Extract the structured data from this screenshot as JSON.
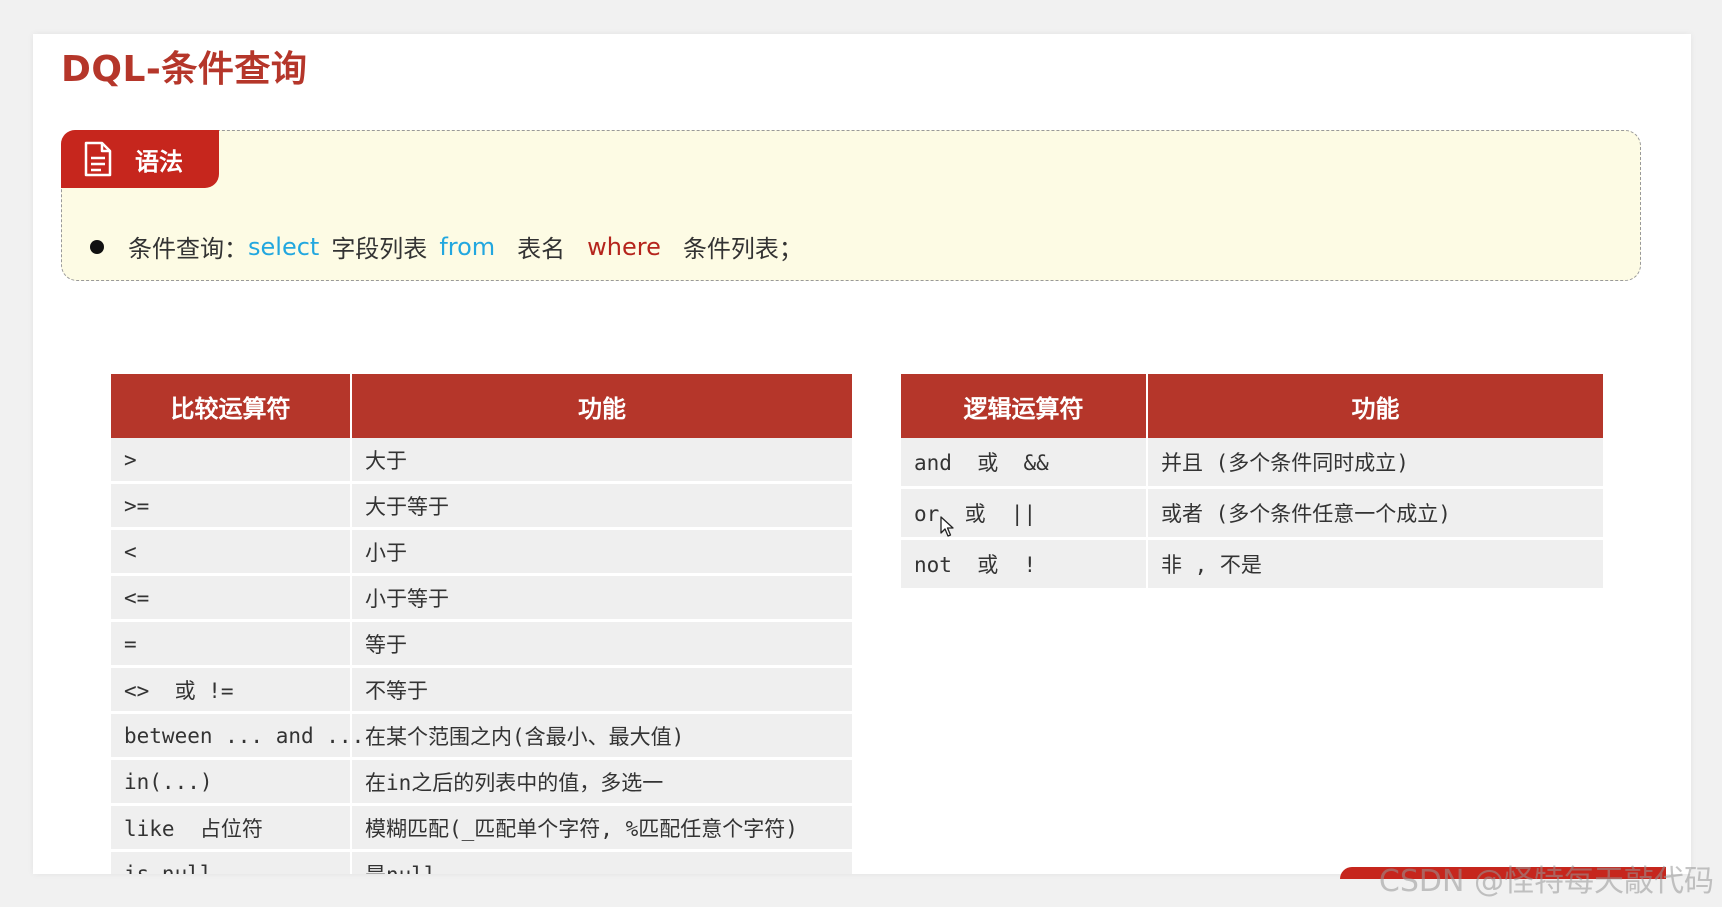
{
  "slide": {
    "title": "DQL-条件查询"
  },
  "syntax": {
    "tag_label": "语法",
    "prefix": "条件查询：",
    "kw_select": "select",
    "fields": "字段列表",
    "kw_from": "from",
    "table_name": "表名",
    "kw_where": "where",
    "conditions": "条件列表；"
  },
  "comparison_table": {
    "headers": [
      "比较运算符",
      "功能"
    ],
    "rows": [
      [
        ">",
        "大于"
      ],
      [
        ">=",
        "大于等于"
      ],
      [
        "<",
        "小于"
      ],
      [
        "<=",
        "小于等于"
      ],
      [
        "=",
        "等于"
      ],
      [
        "<>  或 !=",
        "不等于"
      ],
      [
        "between ... and ...",
        "在某个范围之内(含最小、最大值)"
      ],
      [
        "in(...)",
        "在in之后的列表中的值，多选一"
      ],
      [
        "like  占位符",
        "模糊匹配(_匹配单个字符, %匹配任意个字符)"
      ],
      [
        "is null",
        "是null"
      ]
    ]
  },
  "logical_table": {
    "headers": [
      "逻辑运算符",
      "功能"
    ],
    "rows": [
      [
        "and  或  &&",
        "并且 (多个条件同时成立)"
      ],
      [
        "or  或  ||",
        "或者 (多个条件任意一个成立)"
      ],
      [
        "not  或  !",
        "非 , 不是"
      ]
    ]
  },
  "watermark": "CSDN @怪特每天敲代码",
  "colors": {
    "title_red": "#b5362a",
    "header_red": "#b5362a",
    "tag_red": "#c6261d",
    "keyword_blue": "#22a7df",
    "keyword_red": "#b5241c",
    "box_bg": "#fdfbe4",
    "row_bg": "#efefef"
  },
  "icons": {
    "tag": "document-icon",
    "pointer": "mouse-cursor-icon"
  }
}
